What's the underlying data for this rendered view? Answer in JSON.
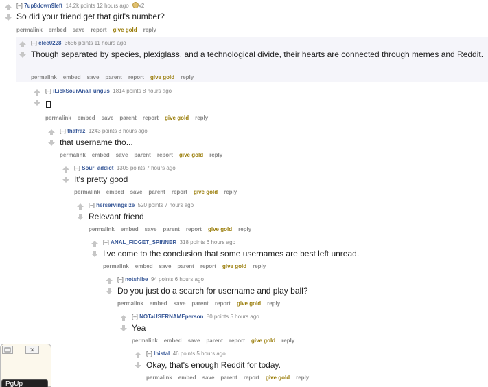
{
  "actions": {
    "permalink": "permalink",
    "embed": "embed",
    "save": "save",
    "parent": "parent",
    "report": "report",
    "give_gold": "give gold",
    "reply": "reply"
  },
  "comments": [
    {
      "toggle": "[–]",
      "author": "7up8down9left",
      "score": "14.2k points",
      "time": "12 hours ago",
      "gilded": "x2",
      "body": "So did your friend get that girl's number?"
    },
    {
      "toggle": "[–]",
      "author": "elee0228",
      "score": "3656 points",
      "time": "11 hours ago",
      "body": "Though separated by species, plexiglass, and a technological divide, their hearts are connected through memes and Reddit."
    },
    {
      "toggle": "[–]",
      "author": "iLickSourAnalFungus",
      "score": "1814 points",
      "time": "8 hours ago",
      "body": ""
    },
    {
      "toggle": "[–]",
      "author": "thafraz",
      "score": "1243 points",
      "time": "8 hours ago",
      "body": "that username tho..."
    },
    {
      "toggle": "[–]",
      "author": "Sour_addict",
      "score": "1305 points",
      "time": "7 hours ago",
      "body": "It's pretty good"
    },
    {
      "toggle": "[–]",
      "author": "herservingsize",
      "score": "520 points",
      "time": "7 hours ago",
      "body": "Relevant friend"
    },
    {
      "toggle": "[–]",
      "author": "ANAL_FIDGET_SPINNER",
      "score": "318 points",
      "time": "6 hours ago",
      "body": "I've come to the conclusion that some usernames are best left unread."
    },
    {
      "toggle": "[–]",
      "author": "notshibe",
      "score": "94 points",
      "time": "6 hours ago",
      "body": "Do you just do a search for username and play ball?"
    },
    {
      "toggle": "[–]",
      "author": "NOTaUSERNAMEperson",
      "score": "80 points",
      "time": "5 hours ago",
      "body": "Yea"
    },
    {
      "toggle": "[–]",
      "author": "Ihistal",
      "score": "46 points",
      "time": "5 hours ago",
      "body": "Okay, that's enough Reddit for today."
    }
  ],
  "overlay": {
    "restore_icon": "restore-icon",
    "close_label": "✕",
    "pgup_label": "PgUp"
  },
  "colors": {
    "author": "#3a5a99",
    "give_gold": "#9a7d0a",
    "shaded_background": "#f5f5fa"
  }
}
